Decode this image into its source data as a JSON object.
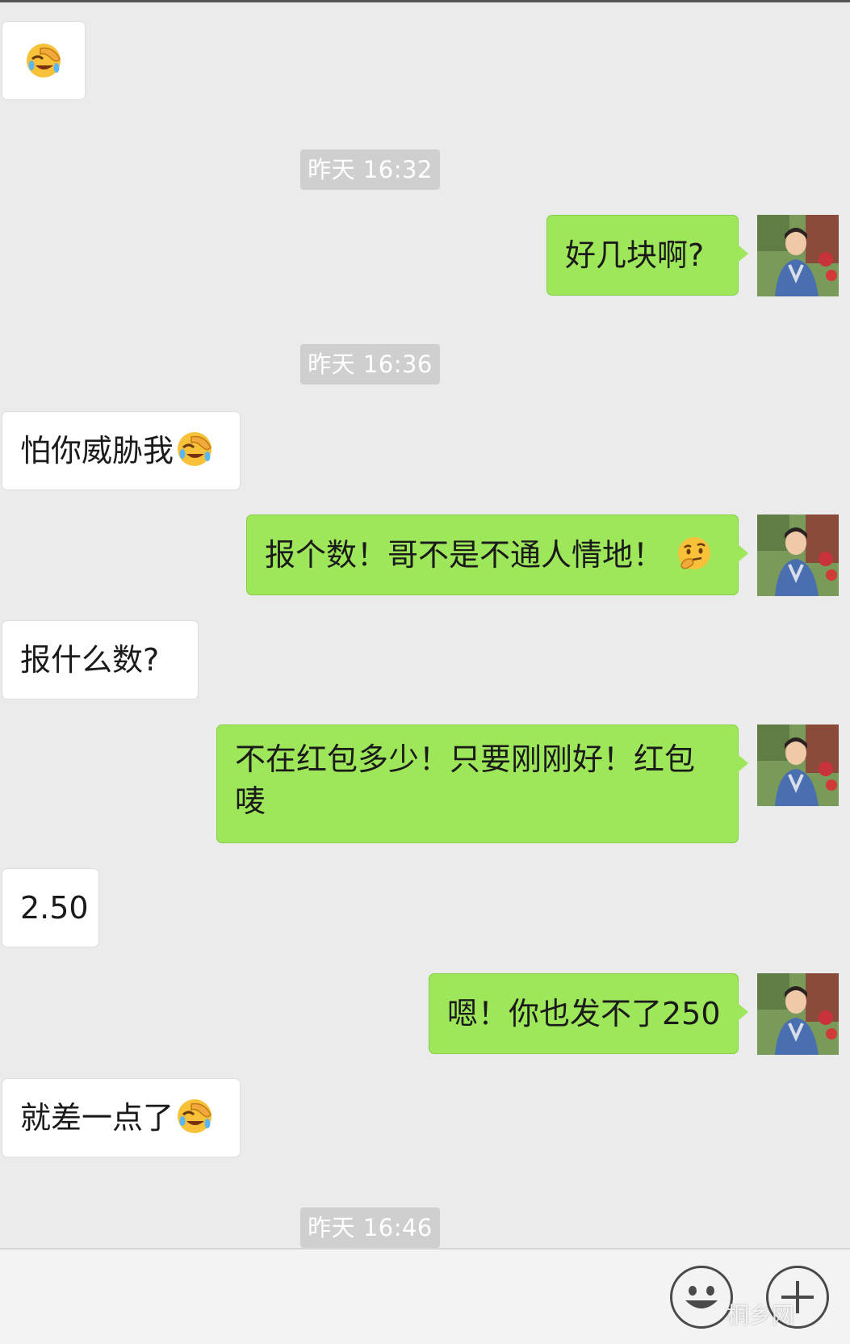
{
  "messages": [
    {
      "side": "left",
      "text": "",
      "emoji": "facepalm-laugh"
    },
    {
      "side": "time",
      "text": "昨天 16:32"
    },
    {
      "side": "right",
      "text": "好几块啊?"
    },
    {
      "side": "time",
      "text": "昨天 16:36"
    },
    {
      "side": "left",
      "text": "怕你威胁我",
      "emoji": "facepalm-laugh"
    },
    {
      "side": "right",
      "text": "报个数！哥不是不通人情地！",
      "emoji": "thinking-face"
    },
    {
      "side": "left",
      "text": "报什么数?"
    },
    {
      "side": "right",
      "text": "不在红包多少！只要刚刚好！红包唛"
    },
    {
      "side": "left",
      "text": "2.50"
    },
    {
      "side": "right",
      "text": "嗯！你也发不了250"
    },
    {
      "side": "left",
      "text": "就差一点了",
      "emoji": "facepalm-laugh"
    },
    {
      "side": "time",
      "text": "昨天 16:46"
    }
  ],
  "toolbar": {
    "emoji_button_icon": "smiley-face-icon",
    "more_button_icon": "plus-icon"
  },
  "watermark": "桐乡网",
  "colors": {
    "background": "#ebebeb",
    "sent_bubble": "#9ee65a",
    "received_bubble": "#ffffff",
    "timestamp_bg": "#cfcfcf"
  }
}
